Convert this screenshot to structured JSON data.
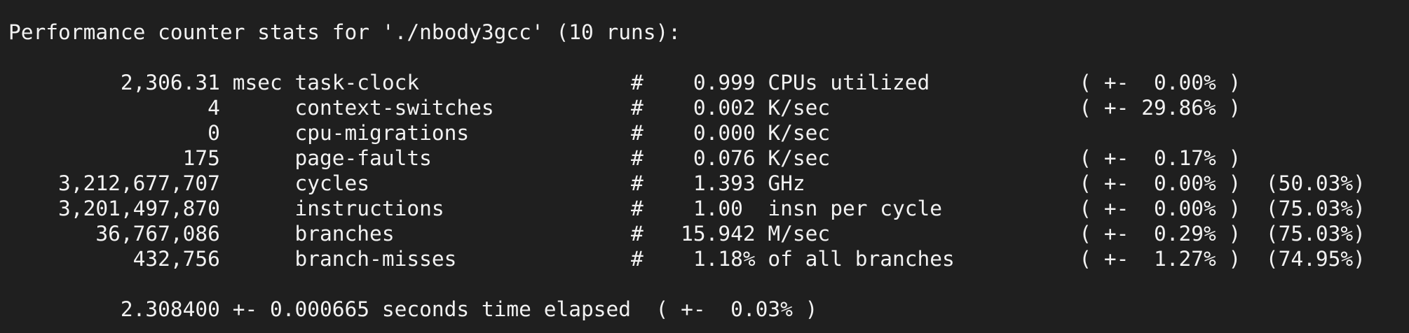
{
  "terminal": {
    "header": "Performance counter stats for './nbody3gcc' (10 runs):",
    "rows": [
      "         2,306.31 msec task-clock                 #    0.999 CPUs utilized            ( +-  0.00% )",
      "                4      context-switches           #    0.002 K/sec                    ( +- 29.86% )",
      "                0      cpu-migrations             #    0.000 K/sec",
      "              175      page-faults                #    0.076 K/sec                    ( +-  0.17% )",
      "    3,212,677,707      cycles                     #    1.393 GHz                      ( +-  0.00% )  (50.03%)",
      "    3,201,497,870      instructions               #    1.00  insn per cycle           ( +-  0.00% )  (75.03%)",
      "       36,767,086      branches                   #   15.942 M/sec                    ( +-  0.29% )  (75.03%)",
      "          432,756      branch-misses              #    1.18% of all branches          ( +-  1.27% )  (74.95%)"
    ],
    "elapsed": "         2.308400 +- 0.000665 seconds time elapsed  ( +-  0.03% )"
  }
}
